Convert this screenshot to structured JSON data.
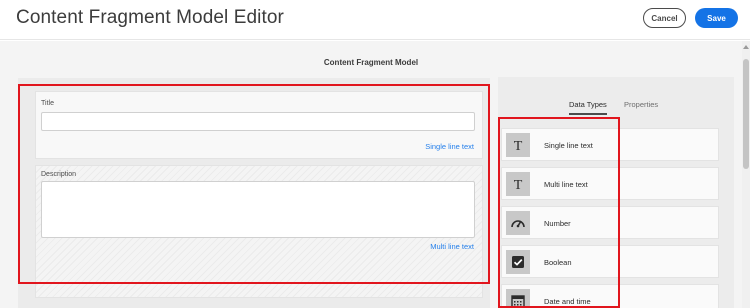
{
  "header": {
    "title": "Content Fragment Model Editor",
    "cancel_label": "Cancel",
    "save_label": "Save"
  },
  "canvas": {
    "heading": "Content Fragment Model"
  },
  "fields": [
    {
      "label": "Title",
      "value": "",
      "type_label": "Single line text"
    },
    {
      "label": "Description",
      "value": "",
      "type_label": "Multi line text"
    }
  ],
  "sidebar": {
    "tabs": [
      {
        "label": "Data Types",
        "active": true
      },
      {
        "label": "Properties",
        "active": false
      }
    ],
    "data_types": [
      {
        "label": "Single line text",
        "icon": "text-t-icon"
      },
      {
        "label": "Multi line text",
        "icon": "text-t-icon"
      },
      {
        "label": "Number",
        "icon": "gauge-icon"
      },
      {
        "label": "Boolean",
        "icon": "checkbox-icon"
      },
      {
        "label": "Date and time",
        "icon": "calendar-icon"
      }
    ]
  },
  "colors": {
    "accent": "#1473e6",
    "link": "#2680eb",
    "highlight": "#e1151d"
  }
}
